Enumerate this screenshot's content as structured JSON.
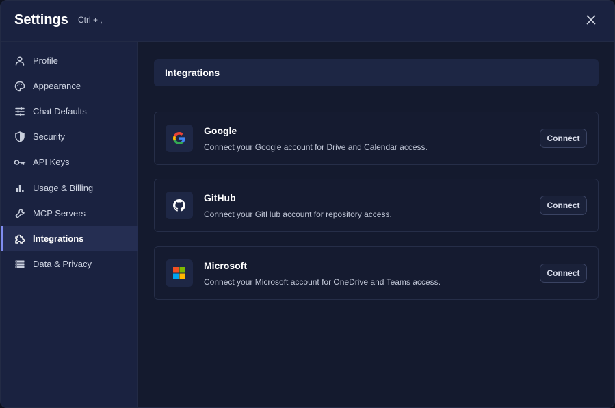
{
  "header": {
    "title": "Settings",
    "shortcut": "Ctrl + ,",
    "close_icon": "close-icon"
  },
  "sidebar": {
    "active_index": 7,
    "accent_color": "#7f8cf0",
    "items": [
      {
        "label": "Profile",
        "icon": "user-icon"
      },
      {
        "label": "Appearance",
        "icon": "palette-icon"
      },
      {
        "label": "Chat Defaults",
        "icon": "sliders-icon"
      },
      {
        "label": "Security",
        "icon": "shield-icon"
      },
      {
        "label": "API Keys",
        "icon": "key-icon"
      },
      {
        "label": "Usage & Billing",
        "icon": "bar-chart-icon"
      },
      {
        "label": "MCP Servers",
        "icon": "wrench-icon"
      },
      {
        "label": "Integrations",
        "icon": "puzzle-icon"
      },
      {
        "label": "Data & Privacy",
        "icon": "storage-icon"
      }
    ]
  },
  "main": {
    "section_title": "Integrations",
    "integrations": [
      {
        "name": "Google",
        "description": "Connect your Google account for Drive and Calendar access.",
        "button_label": "Connect",
        "icon": "google-logo-icon"
      },
      {
        "name": "GitHub",
        "description": "Connect your GitHub account for repository access.",
        "button_label": "Connect",
        "icon": "github-logo-icon"
      },
      {
        "name": "Microsoft",
        "description": "Connect your Microsoft account for OneDrive and Teams access.",
        "button_label": "Connect",
        "icon": "microsoft-logo-icon"
      }
    ]
  }
}
